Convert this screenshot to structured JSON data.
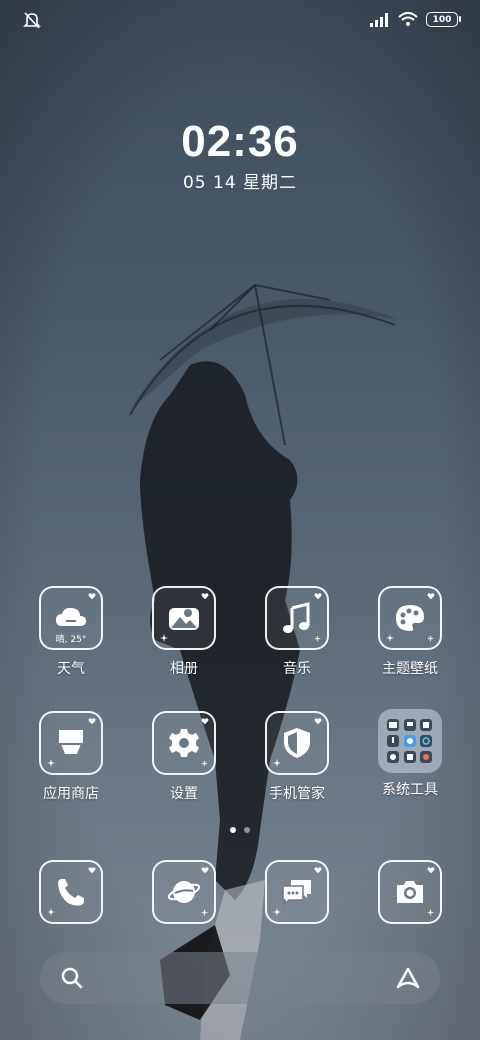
{
  "status": {
    "battery": "100"
  },
  "clock": {
    "time": "02:36",
    "date": "05  14  星期二"
  },
  "apps": [
    {
      "label": "天气",
      "sub": "晴, 25°"
    },
    {
      "label": "相册"
    },
    {
      "label": "音乐"
    },
    {
      "label": "主题壁纸"
    },
    {
      "label": "应用商店"
    },
    {
      "label": "设置"
    },
    {
      "label": "手机管家"
    },
    {
      "label": "系统工具"
    }
  ],
  "dock": [
    "phone-icon",
    "browser-icon",
    "messages-icon",
    "camera-icon"
  ],
  "pages": {
    "count": 2,
    "active": 1
  }
}
